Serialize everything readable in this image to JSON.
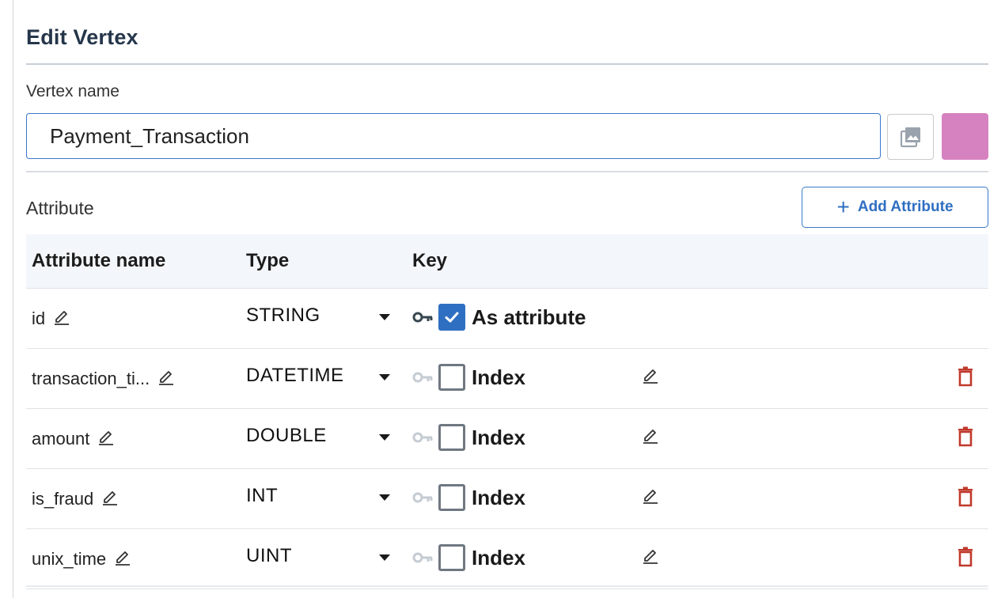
{
  "header": {
    "title": "Edit Vertex"
  },
  "vertex": {
    "name_label": "Vertex name",
    "name_value": "Payment_Transaction",
    "color": "#d682c0"
  },
  "attributes": {
    "section_label": "Attribute",
    "add_button_label": "Add Attribute",
    "columns": {
      "name": "Attribute name",
      "type": "Type",
      "key": "Key"
    },
    "rows": [
      {
        "name": "id",
        "type": "STRING",
        "key_label": "As attribute",
        "checked": true,
        "primary": true
      },
      {
        "name": "transaction_ti...",
        "type": "DATETIME",
        "key_label": "Index",
        "checked": false,
        "primary": false
      },
      {
        "name": "amount",
        "type": "DOUBLE",
        "key_label": "Index",
        "checked": false,
        "primary": false
      },
      {
        "name": "is_fraud",
        "type": "INT",
        "key_label": "Index",
        "checked": false,
        "primary": false
      },
      {
        "name": "unix_time",
        "type": "UINT",
        "key_label": "Index",
        "checked": false,
        "primary": false
      }
    ]
  },
  "colors": {
    "accent": "#2f6fc2",
    "danger": "#c0392b",
    "key_active": "#37474f",
    "key_inactive": "#c5ccd3"
  }
}
